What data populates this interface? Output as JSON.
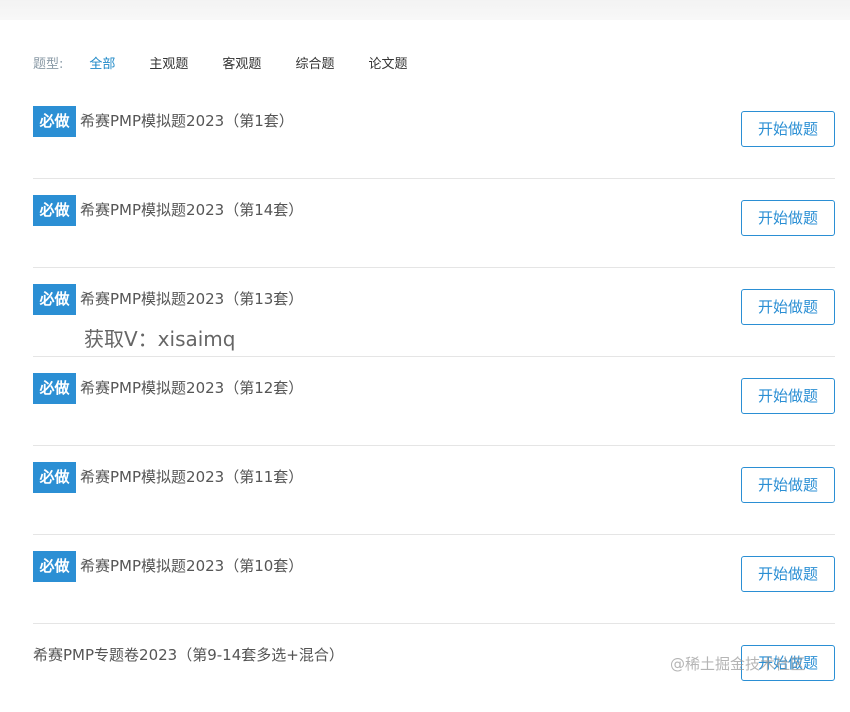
{
  "filter": {
    "label": "题型:",
    "options": [
      "全部",
      "主观题",
      "客观题",
      "综合题",
      "论文题"
    ],
    "active_index": 0
  },
  "exams": [
    {
      "badge": "必做",
      "title": "希赛PMP模拟题2023（第1套）",
      "button": "开始做题"
    },
    {
      "badge": "必做",
      "title": "希赛PMP模拟题2023（第14套）",
      "button": "开始做题"
    },
    {
      "badge": "必做",
      "title": "希赛PMP模拟题2023（第13套）",
      "button": "开始做题"
    },
    {
      "badge": "必做",
      "title": "希赛PMP模拟题2023（第12套）",
      "button": "开始做题"
    },
    {
      "badge": "必做",
      "title": "希赛PMP模拟题2023（第11套）",
      "button": "开始做题"
    },
    {
      "badge": "必做",
      "title": "希赛PMP模拟题2023（第10套）",
      "button": "开始做题"
    },
    {
      "badge": "",
      "title": "希赛PMP专题卷2023（第9-14套多选+混合）",
      "button": "开始做题"
    }
  ],
  "overlay_text": "获取V：xisaimq",
  "watermark": "@稀土掘金技术社区",
  "colors": {
    "accent": "#2b8fd4",
    "active_filter": "#1e88c7",
    "divider": "#e5e5e5"
  }
}
